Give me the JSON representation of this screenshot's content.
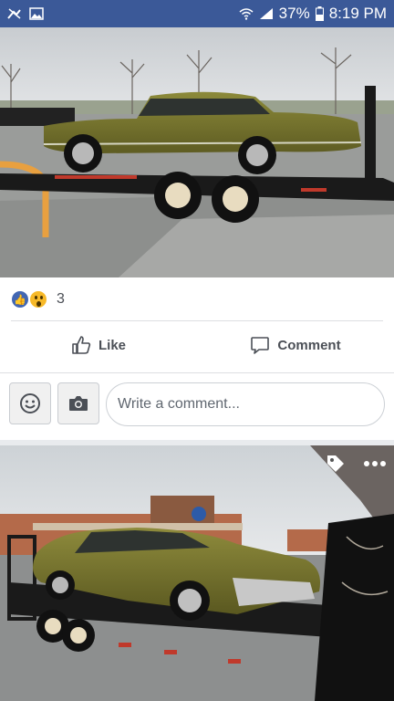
{
  "status": {
    "battery": "37%",
    "time": "8:19 PM"
  },
  "post": {
    "reaction_count": "3",
    "actions": {
      "like": "Like",
      "comment": "Comment"
    }
  },
  "comment_box": {
    "placeholder": "Write a comment..."
  },
  "icons": {
    "status_left": [
      "notifications-off-icon",
      "image-icon"
    ],
    "status_right": [
      "wifi-icon",
      "signal-icon",
      "battery-icon"
    ],
    "photo_overlay": [
      "tag-icon",
      "more-icon"
    ]
  },
  "colors": {
    "facebook_blue": "#3b5998",
    "like_blue": "#4267b2",
    "wow_yellow": "#f7b928"
  }
}
